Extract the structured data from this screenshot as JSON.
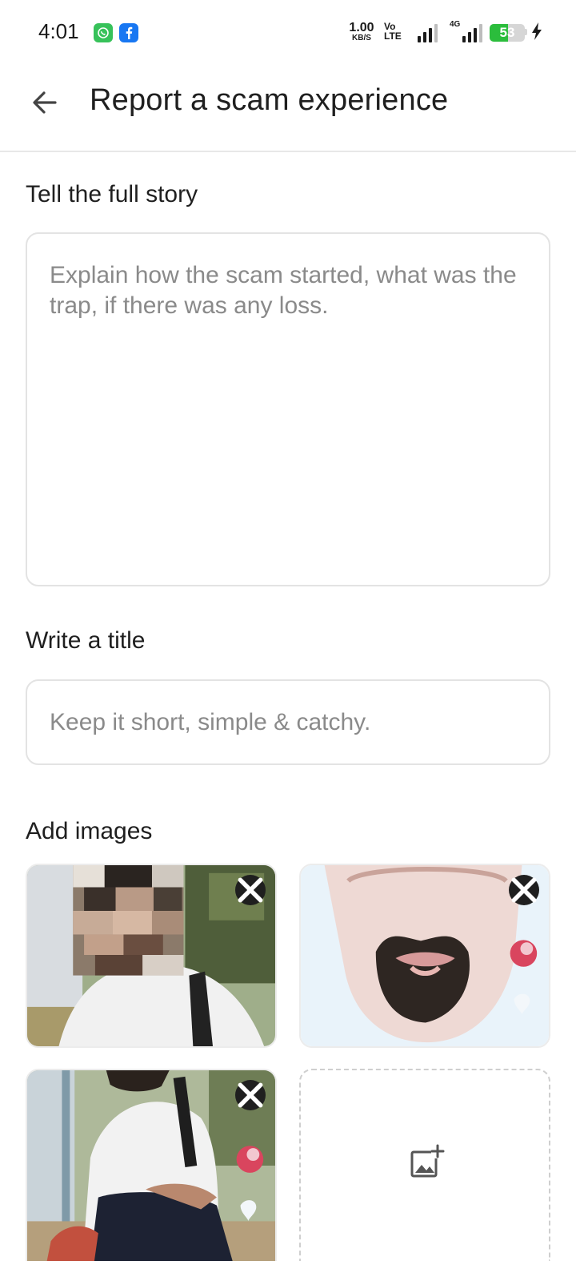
{
  "status_bar": {
    "time": "4:01",
    "apps": [
      "whatsapp-icon",
      "facebook-icon"
    ],
    "net_speed_value": "1.00",
    "net_speed_unit": "KB/S",
    "volte_top": "Vo",
    "volte_bottom": "LTE",
    "network_type": "4G",
    "battery_percent": 53,
    "battery_text": "53",
    "charging": true
  },
  "app_bar": {
    "back_icon": "arrow-left-icon",
    "title": "Report a scam experience"
  },
  "form": {
    "story_label": "Tell the full story",
    "story_placeholder": "Explain how the scam started, what was the trap, if there was any loss.",
    "title_label": "Write a title",
    "title_placeholder": "Keep it short, simple & catchy.",
    "images_label": "Add images",
    "images": [
      {
        "name": "uploaded-image-1",
        "remove_icon": "close-icon"
      },
      {
        "name": "uploaded-image-2",
        "remove_icon": "close-icon"
      },
      {
        "name": "uploaded-image-3",
        "remove_icon": "close-icon"
      }
    ],
    "add_image_icon": "add-photo-icon"
  },
  "colors": {
    "text_primary": "#1f1f1f",
    "placeholder": "#8a8a8a",
    "border": "#e3e3e3",
    "battery_green": "#2bbd3c",
    "whatsapp_green": "#37c25a",
    "facebook_blue": "#1877f2"
  }
}
